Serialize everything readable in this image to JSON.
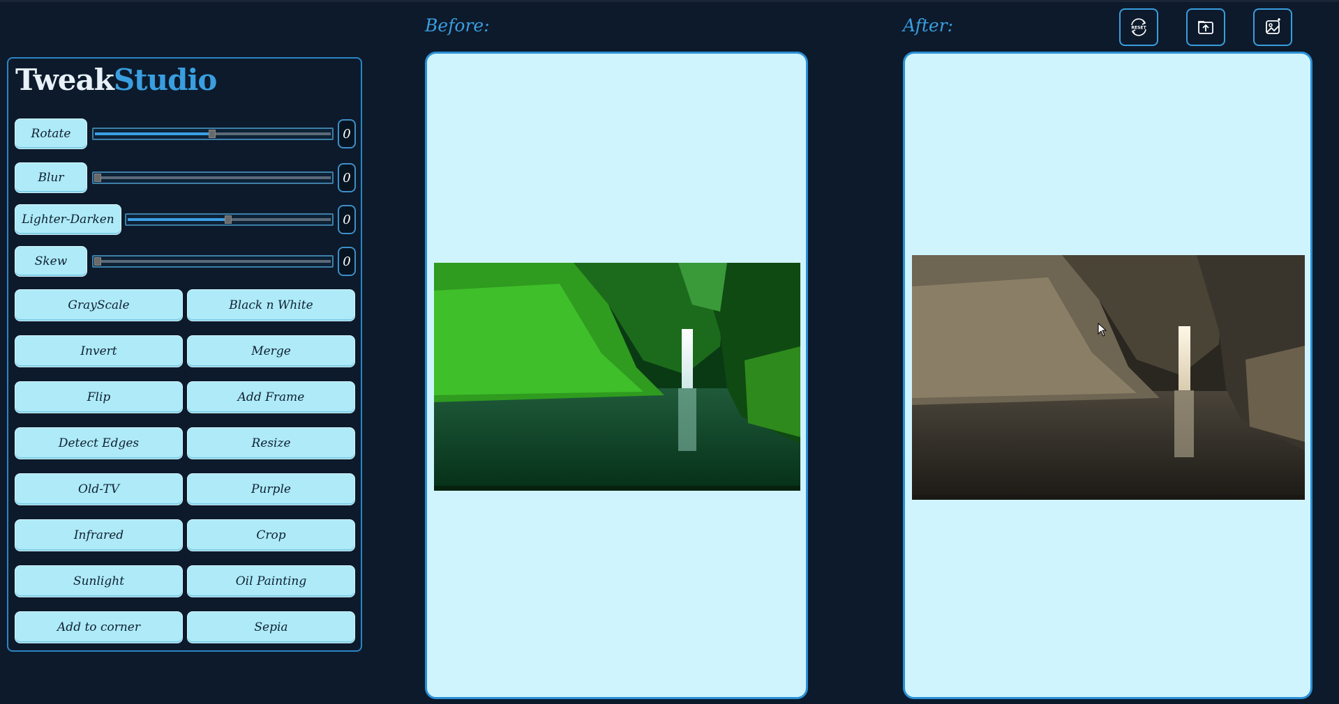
{
  "app": {
    "logo_part1": "Tweak",
    "logo_part2": "Studio"
  },
  "sliders": [
    {
      "label": "Rotate",
      "value": "0",
      "level": 0.5
    },
    {
      "label": "Blur",
      "value": "0",
      "level": 0.0
    },
    {
      "label": "Lighter-Darken",
      "value": "0",
      "level": 0.5
    },
    {
      "label": "Skew",
      "value": "0",
      "level": 0.0
    }
  ],
  "effects": [
    "GrayScale",
    "Black n White",
    "Invert",
    "Merge",
    "Flip",
    "Add Frame",
    "Detect Edges",
    "Resize",
    "Old-TV",
    "Purple",
    "Infrared",
    "Crop",
    "Sunlight",
    "Oil Painting",
    "Add to corner",
    "Sepia"
  ],
  "before": {
    "heading": "Before:"
  },
  "after": {
    "heading": "After:"
  },
  "toolbar": {
    "reset_icon_text": "RESET",
    "icons": [
      "reset-icon",
      "upload-icon",
      "save-image-icon"
    ]
  },
  "colors": {
    "background": "#0c1a2b",
    "accent": "#3a9ee0",
    "button": "#aeeaf8",
    "panel": "#cff4fd"
  }
}
